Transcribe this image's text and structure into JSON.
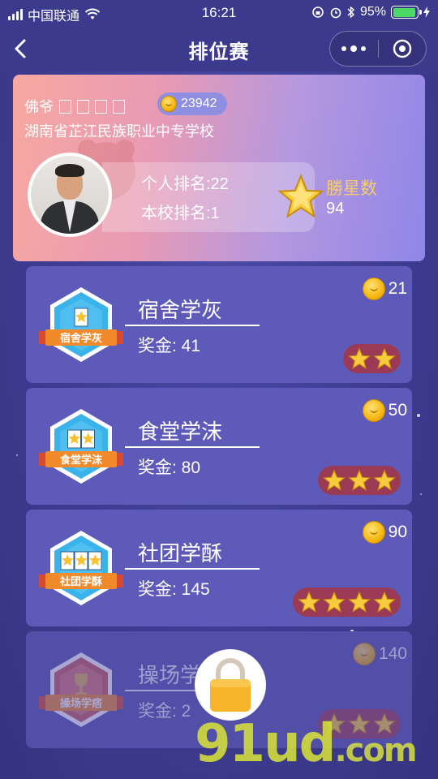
{
  "status_bar": {
    "carrier": "中国联通",
    "time": "16:21",
    "battery": "95%",
    "battery_level": 0.95
  },
  "nav": {
    "title": "排位赛"
  },
  "profile": {
    "name": "佛爷",
    "coins": "23942",
    "school": "湖南省芷江民族职业中专学校",
    "personal_rank": "个人排名:22",
    "school_rank": "本校排名:1",
    "stars_label": "勝星数",
    "stars_value": "94"
  },
  "levels": [
    {
      "title": "宿舍学灰",
      "reward": "奖金: 41",
      "cost": "21",
      "badge_text": "宿舍学灰",
      "badge_stars": 1,
      "stars": 2,
      "locked": false
    },
    {
      "title": "食堂学沫",
      "reward": "奖金: 80",
      "cost": "50",
      "badge_text": "食堂学沫",
      "badge_stars": 2,
      "stars": 3,
      "locked": false
    },
    {
      "title": "社团学酥",
      "reward": "奖金: 145",
      "cost": "90",
      "badge_text": "社团学酥",
      "badge_stars": 3,
      "stars": 4,
      "locked": false
    },
    {
      "title": "操场学",
      "reward": "奖金: 2",
      "cost": "140",
      "badge_text": "操场学痞",
      "badge_stars": 0,
      "stars": 3,
      "locked": true
    }
  ],
  "watermark": {
    "main": "91ud",
    "suffix": ".com"
  },
  "colors": {
    "background": "#3f3e94",
    "card": "#5d5aba",
    "star_pill": "#9b3a55",
    "gold": "#f6cc6a"
  }
}
